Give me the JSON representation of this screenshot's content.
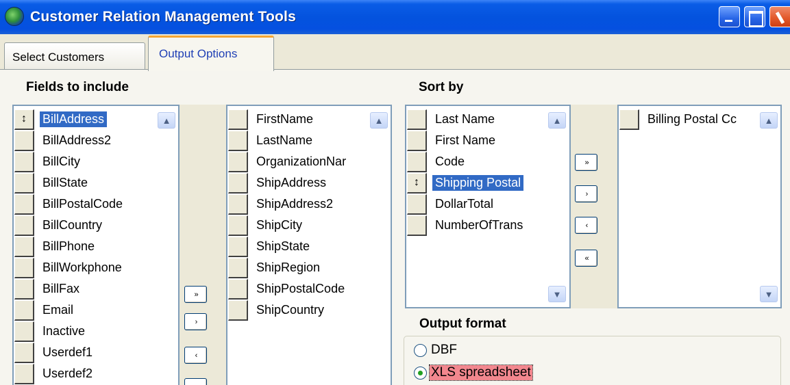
{
  "window": {
    "title": "Customer Relation Management Tools",
    "icon": "globe-icon"
  },
  "tabs": [
    {
      "label": "Select Customers",
      "active": false
    },
    {
      "label": "Output Options",
      "active": true
    }
  ],
  "fields": {
    "label": "Fields to include",
    "available": [
      "BillAddress",
      "BillAddress2",
      "BillCity",
      "BillState",
      "BillPostalCode",
      "BillCountry",
      "BillPhone",
      "BillWorkphone",
      "BillFax",
      "Email",
      "Inactive",
      "Userdef1",
      "Userdef2"
    ],
    "available_selected": "BillAddress",
    "included": [
      "FirstName",
      "LastName",
      "OrganizationNar",
      "ShipAddress",
      "ShipAddress2",
      "ShipCity",
      "ShipState",
      "ShipRegion",
      "ShipPostalCode",
      "ShipCountry"
    ]
  },
  "sort": {
    "label": "Sort by",
    "available": [
      "Last Name",
      "First Name",
      "Code",
      "Shipping Postal",
      "DollarTotal",
      "NumberOfTrans"
    ],
    "available_selected": "Shipping Postal",
    "selected": [
      "Billing Postal Cc"
    ]
  },
  "buttons": {
    "move_all_right": "»",
    "move_right": "›",
    "move_left": "‹",
    "move_all_left": "«"
  },
  "output": {
    "label": "Output format",
    "options": [
      {
        "label": "DBF",
        "checked": false
      },
      {
        "label": "XLS spreadsheet",
        "checked": true
      }
    ]
  },
  "colors": {
    "title_bar": "#0453de",
    "selection": "#316ac5",
    "active_tab_accent": "#f6a531",
    "focused_option": "#f2878e"
  }
}
